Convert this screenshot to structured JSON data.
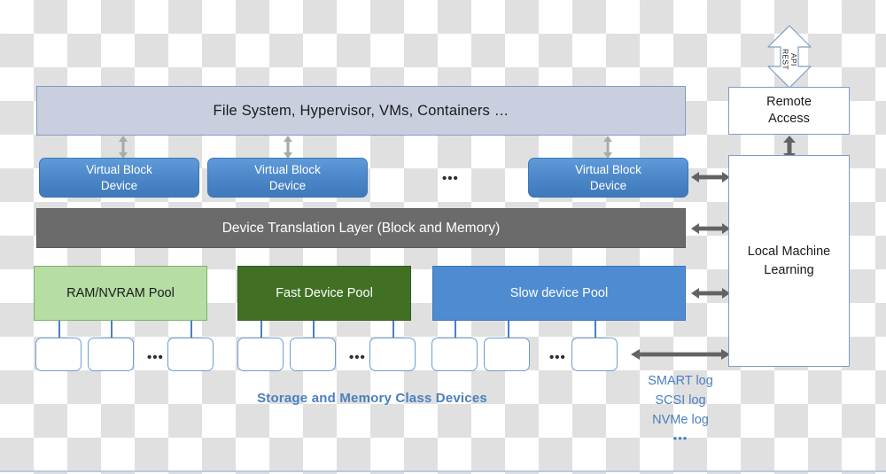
{
  "diagram": {
    "title": "Storage and Memory Class Devices architecture",
    "colors": {
      "app_layer": "#c9cfdf",
      "virtual_block_device": "#4a86c8",
      "translation_layer": "#6b6b6b",
      "ram_pool": "#b5dda4",
      "fast_pool": "#417025",
      "slow_pool": "#4f8bd0",
      "accent_text": "#4a7fbf",
      "arrow_gray": "#636363",
      "arrow_outline": "#6b9ed4"
    }
  },
  "app_layer": {
    "label": "File System, Hypervisor,  VMs, Containers …"
  },
  "virtual_block_devices": [
    {
      "line1": "Virtual Block",
      "line2": "Device"
    },
    {
      "line1": "Virtual Block",
      "line2": "Device"
    },
    {
      "line1": "Virtual Block",
      "line2": "Device"
    }
  ],
  "vbd_ellipsis": "•••",
  "translation_layer": {
    "label": "Device Translation Layer (Block and Memory)"
  },
  "pools": [
    {
      "label": "RAM/NVRAM Pool",
      "ellipsis": "•••"
    },
    {
      "label": "Fast Device Pool",
      "ellipsis": "•••"
    },
    {
      "label": "Slow device Pool",
      "ellipsis": "•••"
    }
  ],
  "captions": {
    "devices": "Storage and Memory Class Devices"
  },
  "logs": {
    "items": [
      "SMART log",
      "SCSI log",
      "NVMe log"
    ],
    "ellipsis": "•••"
  },
  "right_panel": {
    "remote_access": {
      "line1": "Remote",
      "line2": "Access"
    },
    "local_ml": {
      "line1": "Local Machine",
      "line2": "Learning"
    },
    "rest_api": {
      "word1": "REST",
      "word2": "API"
    }
  }
}
